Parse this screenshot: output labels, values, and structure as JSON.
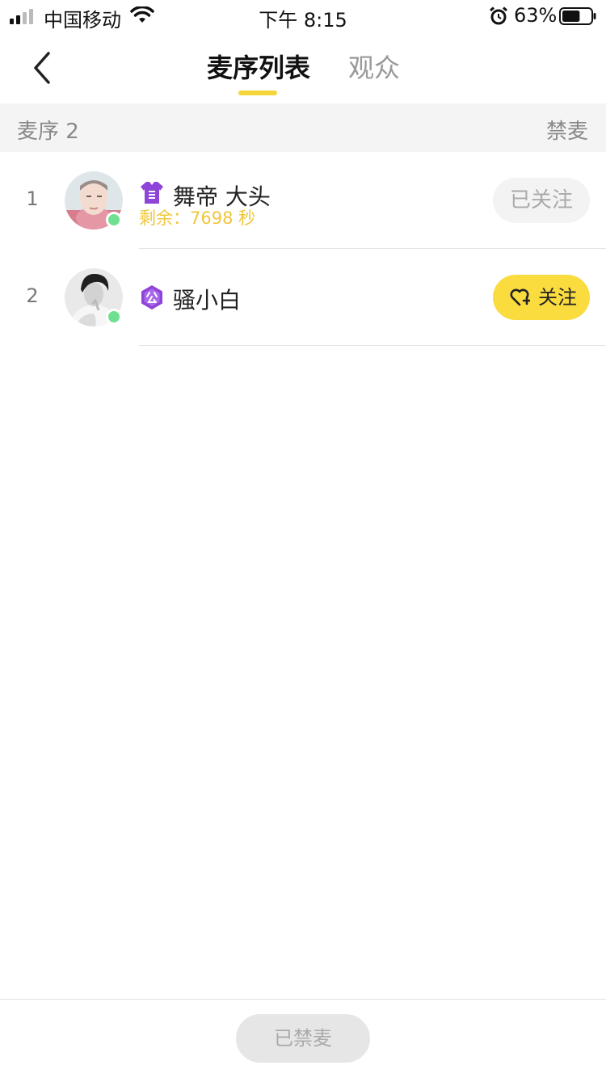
{
  "status_bar": {
    "carrier": "中国移动",
    "time": "下午 8:15",
    "battery_percent": "63%",
    "battery_level": 0.63,
    "icons": [
      "signal-icon",
      "wifi-icon",
      "alarm-icon",
      "battery-icon"
    ]
  },
  "nav": {
    "back_icon": "chevron-left-icon",
    "tabs": [
      {
        "label": "麦序列表",
        "active": true
      },
      {
        "label": "观众",
        "active": false
      }
    ]
  },
  "section": {
    "count_label": "麦序 2",
    "mute_label": "禁麦"
  },
  "queue": [
    {
      "index": "1",
      "name": "舞帝 大头",
      "badge": "vest-badge-icon",
      "remaining": "剩余：7698 秒",
      "online": true,
      "action_label": "已关注",
      "followed": true
    },
    {
      "index": "2",
      "name": "骚小白",
      "badge": "guild-badge-icon",
      "online": true,
      "action_label": "关注",
      "followed": false
    }
  ],
  "footer": {
    "mute_button_label": "已禁麦"
  },
  "colors": {
    "accent_yellow": "#fadc3f",
    "remaining_text": "#f0c63a",
    "online_green": "#6ee08f",
    "badge_purple": "#8e44d8"
  }
}
